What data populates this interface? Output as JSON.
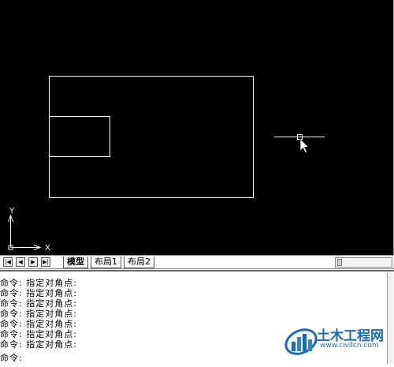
{
  "axis": {
    "x_label": "X",
    "y_label": "Y"
  },
  "nav_buttons": [
    {
      "name": "nav-first-button",
      "glyph": "|◀"
    },
    {
      "name": "nav-prev-button",
      "glyph": "◀"
    },
    {
      "name": "nav-next-button",
      "glyph": "▶"
    },
    {
      "name": "nav-last-button",
      "glyph": "▶|"
    }
  ],
  "tabs": [
    {
      "label": "模型",
      "active": true
    },
    {
      "label": "布局1",
      "active": false
    },
    {
      "label": "布局2",
      "active": false
    }
  ],
  "command_history": [
    "命令: 指定对角点:",
    "命令: 指定对角点:",
    "命令: 指定对角点:",
    "命令: 指定对角点:",
    "命令: 指定对角点:",
    "命令: 指定对角点:",
    "命令: 指定对角点:"
  ],
  "command_prompt": "命令:",
  "watermark": {
    "name_cn": "土木工程网",
    "url": "www.civilcn.com"
  },
  "colors": {
    "canvas_bg": "#000000",
    "geometry": "#ffffff",
    "watermark_blue": "#1b6cb3"
  }
}
